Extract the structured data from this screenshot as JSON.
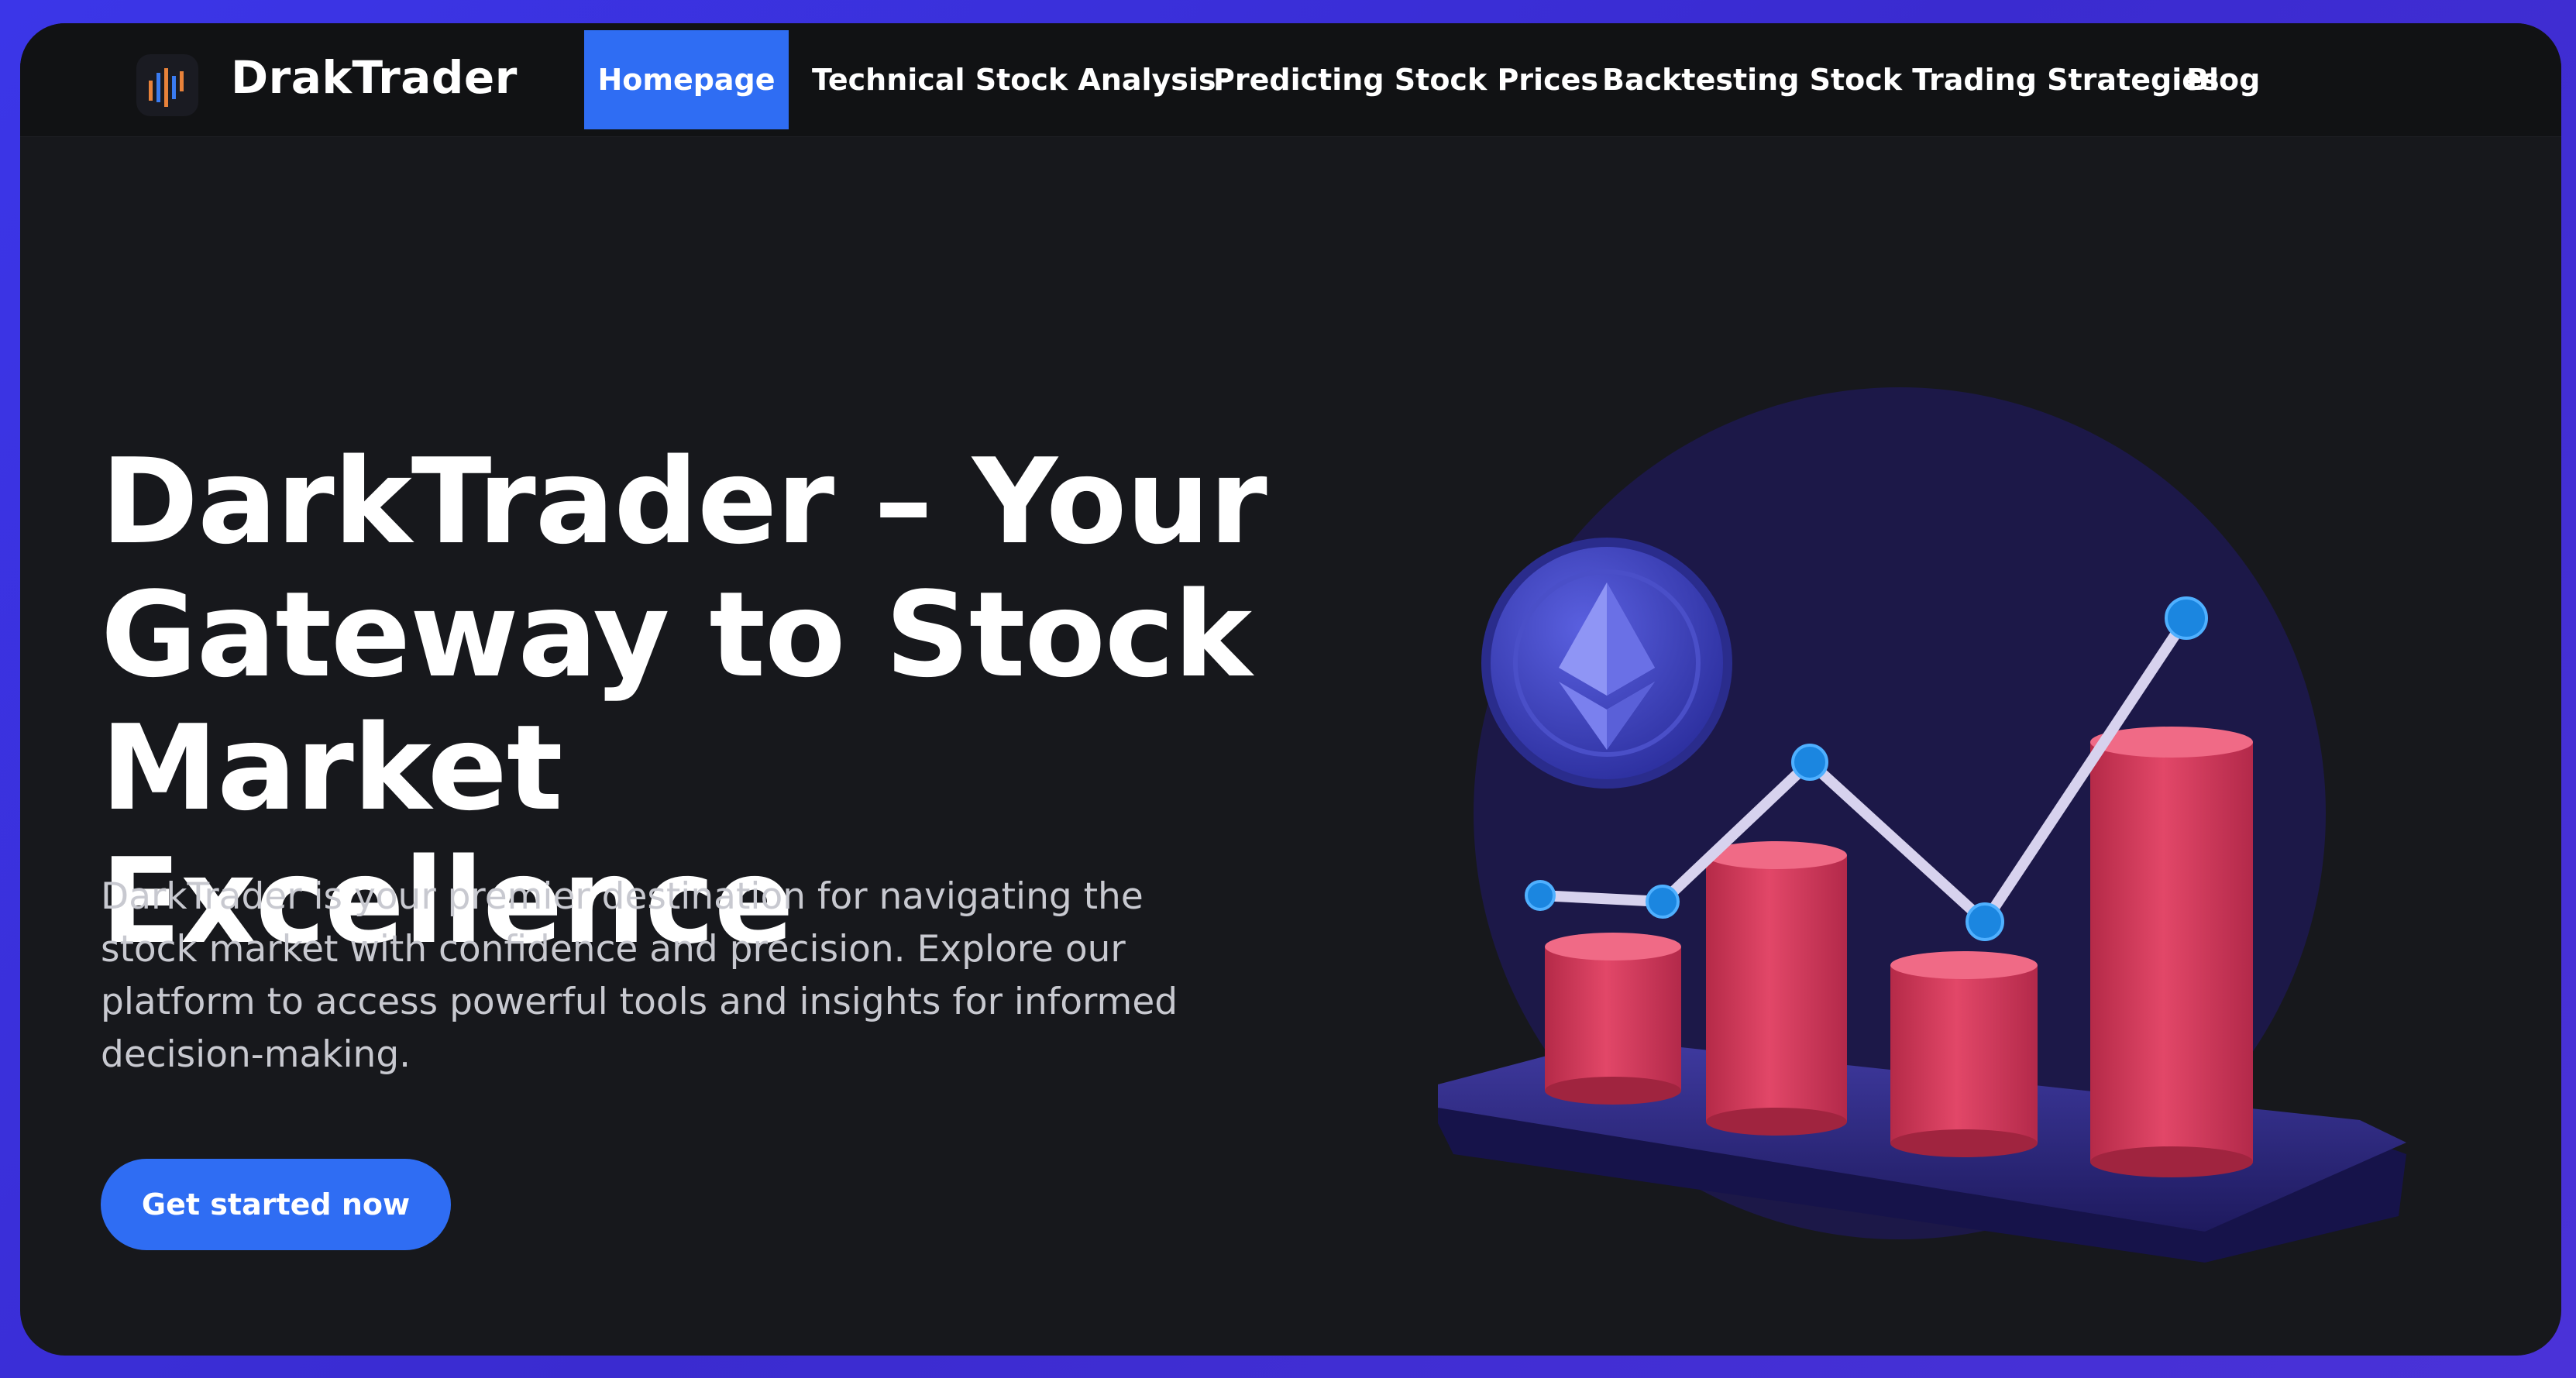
{
  "brand": {
    "name": "DrakTrader",
    "logo_icon": "bar-chart-logo-icon"
  },
  "nav": {
    "items": [
      {
        "label": "Homepage",
        "active": true
      },
      {
        "label": "Technical Stock Analysis",
        "active": false
      },
      {
        "label": "Predicting Stock Prices",
        "active": false
      },
      {
        "label": "Backtesting Stock Trading Strategies",
        "active": false
      },
      {
        "label": "Blog",
        "active": false
      }
    ]
  },
  "hero": {
    "title": "DarkTrader – Your Gateway to Stock Market Excellence",
    "description": "DarkTrader is your premier destination for navigating the stock market with confidence and precision. Explore our platform to access powerful tools and insights for informed decision-making.",
    "cta_label": "Get started now",
    "illustration": "crypto-growth-bar-chart-illustration"
  },
  "colors": {
    "background": "#17181c",
    "navbar": "#111214",
    "accent": "#2f6df3",
    "text": "#ffffff",
    "muted_text": "#c8c9d0",
    "circle": "#1c1848",
    "bars": "#d63a5c",
    "platform": "#34308a",
    "line_nodes": "#1b86e0"
  }
}
